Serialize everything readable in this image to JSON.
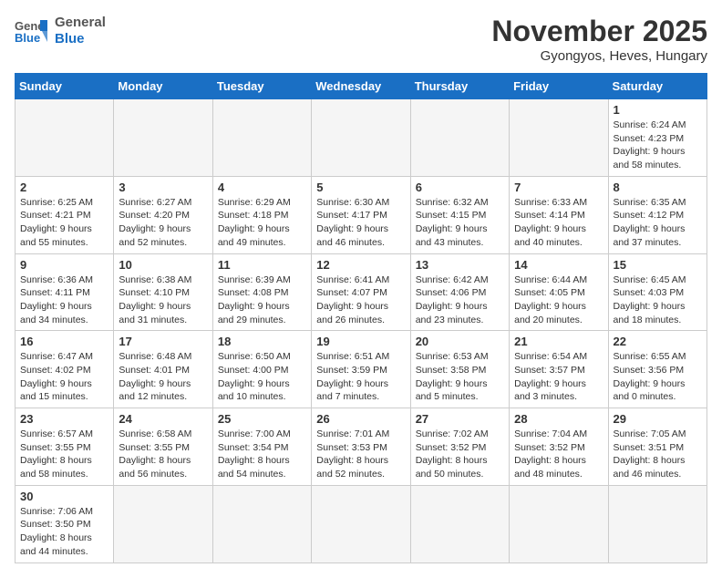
{
  "header": {
    "logo_general": "General",
    "logo_blue": "Blue",
    "month_title": "November 2025",
    "subtitle": "Gyongyos, Heves, Hungary"
  },
  "weekdays": [
    "Sunday",
    "Monday",
    "Tuesday",
    "Wednesday",
    "Thursday",
    "Friday",
    "Saturday"
  ],
  "weeks": [
    [
      {
        "day": "",
        "info": ""
      },
      {
        "day": "",
        "info": ""
      },
      {
        "day": "",
        "info": ""
      },
      {
        "day": "",
        "info": ""
      },
      {
        "day": "",
        "info": ""
      },
      {
        "day": "",
        "info": ""
      },
      {
        "day": "1",
        "info": "Sunrise: 6:24 AM\nSunset: 4:23 PM\nDaylight: 9 hours\nand 58 minutes."
      }
    ],
    [
      {
        "day": "2",
        "info": "Sunrise: 6:25 AM\nSunset: 4:21 PM\nDaylight: 9 hours\nand 55 minutes."
      },
      {
        "day": "3",
        "info": "Sunrise: 6:27 AM\nSunset: 4:20 PM\nDaylight: 9 hours\nand 52 minutes."
      },
      {
        "day": "4",
        "info": "Sunrise: 6:29 AM\nSunset: 4:18 PM\nDaylight: 9 hours\nand 49 minutes."
      },
      {
        "day": "5",
        "info": "Sunrise: 6:30 AM\nSunset: 4:17 PM\nDaylight: 9 hours\nand 46 minutes."
      },
      {
        "day": "6",
        "info": "Sunrise: 6:32 AM\nSunset: 4:15 PM\nDaylight: 9 hours\nand 43 minutes."
      },
      {
        "day": "7",
        "info": "Sunrise: 6:33 AM\nSunset: 4:14 PM\nDaylight: 9 hours\nand 40 minutes."
      },
      {
        "day": "8",
        "info": "Sunrise: 6:35 AM\nSunset: 4:12 PM\nDaylight: 9 hours\nand 37 minutes."
      }
    ],
    [
      {
        "day": "9",
        "info": "Sunrise: 6:36 AM\nSunset: 4:11 PM\nDaylight: 9 hours\nand 34 minutes."
      },
      {
        "day": "10",
        "info": "Sunrise: 6:38 AM\nSunset: 4:10 PM\nDaylight: 9 hours\nand 31 minutes."
      },
      {
        "day": "11",
        "info": "Sunrise: 6:39 AM\nSunset: 4:08 PM\nDaylight: 9 hours\nand 29 minutes."
      },
      {
        "day": "12",
        "info": "Sunrise: 6:41 AM\nSunset: 4:07 PM\nDaylight: 9 hours\nand 26 minutes."
      },
      {
        "day": "13",
        "info": "Sunrise: 6:42 AM\nSunset: 4:06 PM\nDaylight: 9 hours\nand 23 minutes."
      },
      {
        "day": "14",
        "info": "Sunrise: 6:44 AM\nSunset: 4:05 PM\nDaylight: 9 hours\nand 20 minutes."
      },
      {
        "day": "15",
        "info": "Sunrise: 6:45 AM\nSunset: 4:03 PM\nDaylight: 9 hours\nand 18 minutes."
      }
    ],
    [
      {
        "day": "16",
        "info": "Sunrise: 6:47 AM\nSunset: 4:02 PM\nDaylight: 9 hours\nand 15 minutes."
      },
      {
        "day": "17",
        "info": "Sunrise: 6:48 AM\nSunset: 4:01 PM\nDaylight: 9 hours\nand 12 minutes."
      },
      {
        "day": "18",
        "info": "Sunrise: 6:50 AM\nSunset: 4:00 PM\nDaylight: 9 hours\nand 10 minutes."
      },
      {
        "day": "19",
        "info": "Sunrise: 6:51 AM\nSunset: 3:59 PM\nDaylight: 9 hours\nand 7 minutes."
      },
      {
        "day": "20",
        "info": "Sunrise: 6:53 AM\nSunset: 3:58 PM\nDaylight: 9 hours\nand 5 minutes."
      },
      {
        "day": "21",
        "info": "Sunrise: 6:54 AM\nSunset: 3:57 PM\nDaylight: 9 hours\nand 3 minutes."
      },
      {
        "day": "22",
        "info": "Sunrise: 6:55 AM\nSunset: 3:56 PM\nDaylight: 9 hours\nand 0 minutes."
      }
    ],
    [
      {
        "day": "23",
        "info": "Sunrise: 6:57 AM\nSunset: 3:55 PM\nDaylight: 8 hours\nand 58 minutes."
      },
      {
        "day": "24",
        "info": "Sunrise: 6:58 AM\nSunset: 3:55 PM\nDaylight: 8 hours\nand 56 minutes."
      },
      {
        "day": "25",
        "info": "Sunrise: 7:00 AM\nSunset: 3:54 PM\nDaylight: 8 hours\nand 54 minutes."
      },
      {
        "day": "26",
        "info": "Sunrise: 7:01 AM\nSunset: 3:53 PM\nDaylight: 8 hours\nand 52 minutes."
      },
      {
        "day": "27",
        "info": "Sunrise: 7:02 AM\nSunset: 3:52 PM\nDaylight: 8 hours\nand 50 minutes."
      },
      {
        "day": "28",
        "info": "Sunrise: 7:04 AM\nSunset: 3:52 PM\nDaylight: 8 hours\nand 48 minutes."
      },
      {
        "day": "29",
        "info": "Sunrise: 7:05 AM\nSunset: 3:51 PM\nDaylight: 8 hours\nand 46 minutes."
      }
    ],
    [
      {
        "day": "30",
        "info": "Sunrise: 7:06 AM\nSunset: 3:50 PM\nDaylight: 8 hours\nand 44 minutes."
      },
      {
        "day": "",
        "info": ""
      },
      {
        "day": "",
        "info": ""
      },
      {
        "day": "",
        "info": ""
      },
      {
        "day": "",
        "info": ""
      },
      {
        "day": "",
        "info": ""
      },
      {
        "day": "",
        "info": ""
      }
    ]
  ]
}
